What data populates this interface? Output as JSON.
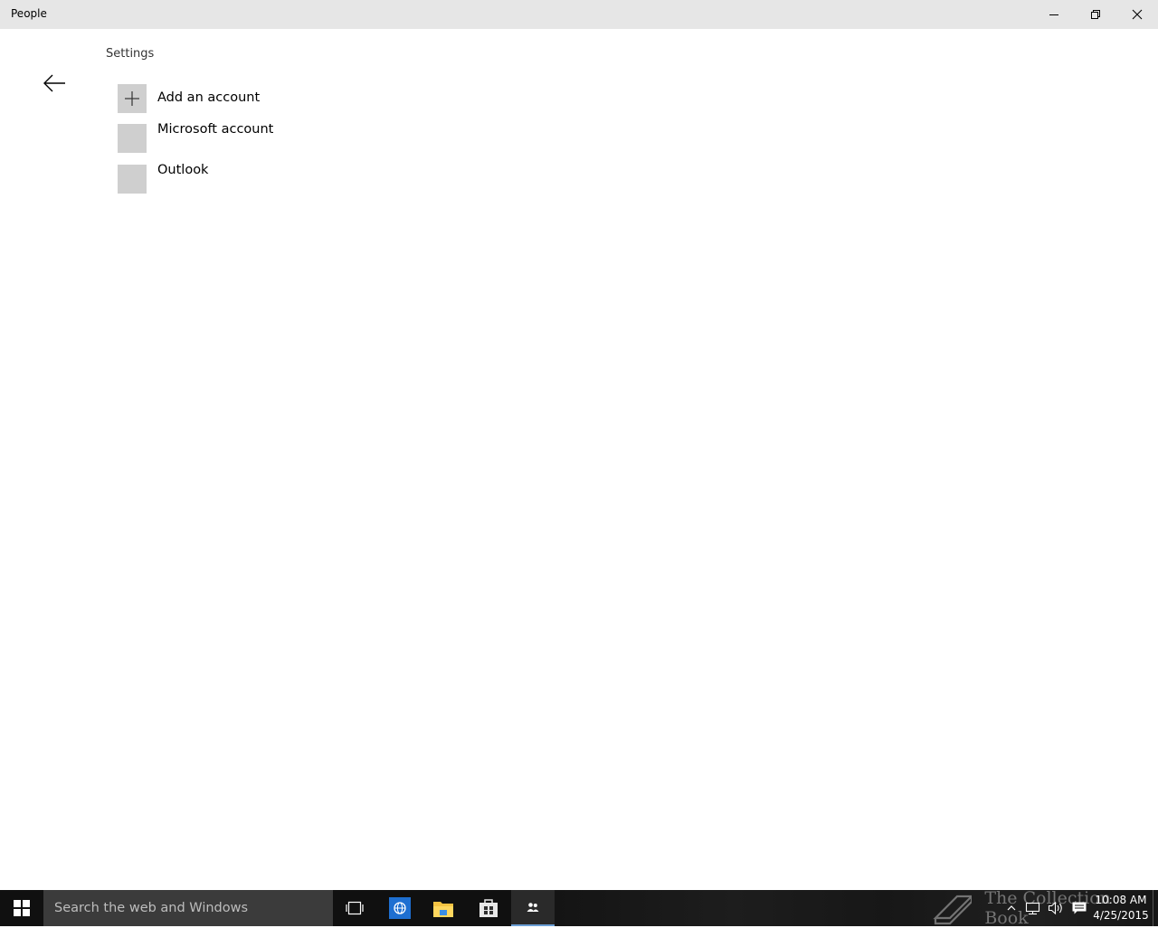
{
  "window": {
    "title": "People",
    "controls": {
      "minimize": "minimize",
      "maximize": "restore",
      "close": "close"
    }
  },
  "page": {
    "section_title": "Settings",
    "accounts": [
      {
        "label": "Add an account",
        "icon": "plus-icon"
      },
      {
        "label": "Microsoft account",
        "icon": ""
      },
      {
        "label": "Outlook",
        "icon": ""
      }
    ]
  },
  "taskbar": {
    "search_placeholder": "Search the web and Windows",
    "pinned": [
      "task-view",
      "internet-explorer",
      "file-explorer",
      "store",
      "people"
    ],
    "watermark": "The Collection Book",
    "clock": {
      "time": "10:08 AM",
      "date": "4/25/2015"
    }
  },
  "colors": {
    "titlebar_bg": "#e6e6e6",
    "tile_bg": "#cfcfcf",
    "taskbar_bg": "#101010",
    "ie_blue": "#1e6fd1",
    "explorer_yellow": "#f5c342"
  }
}
